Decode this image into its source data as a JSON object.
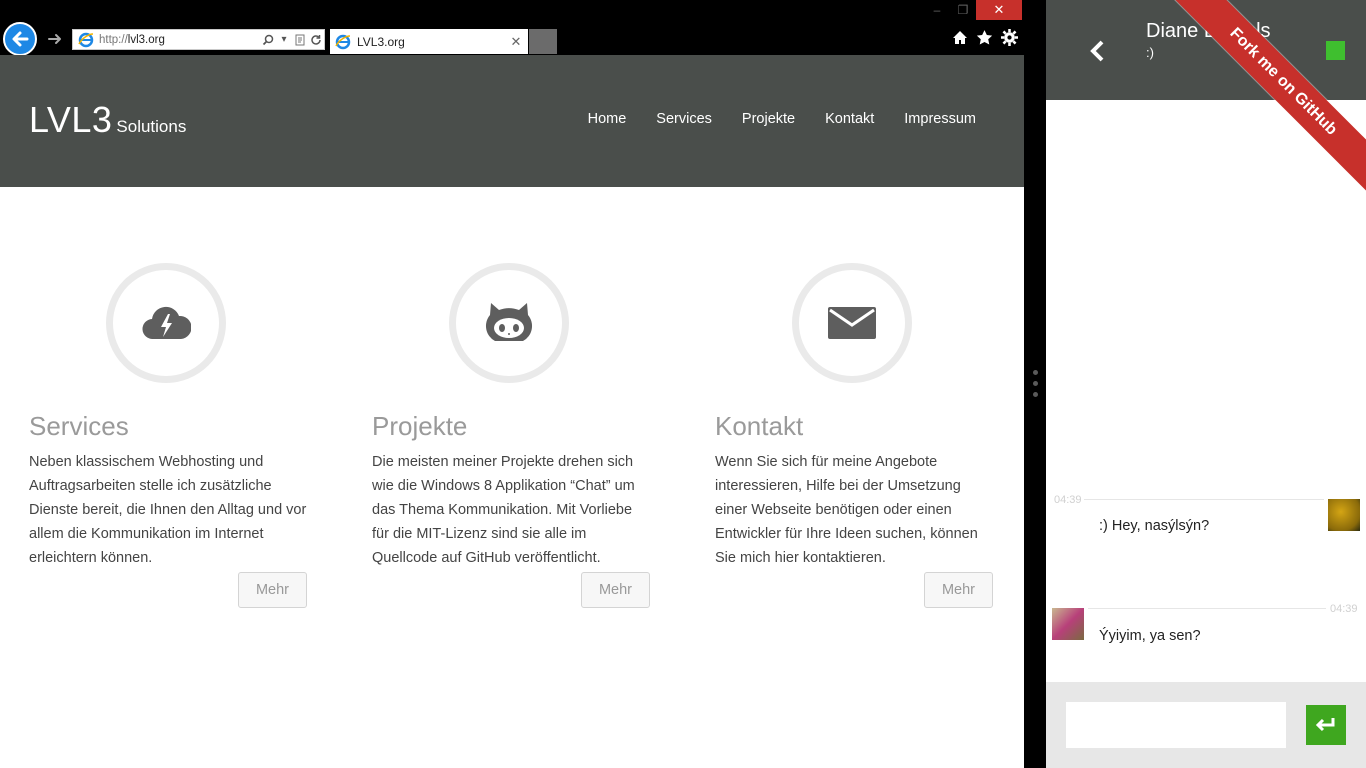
{
  "browser": {
    "address_url_dim": "http://",
    "address_url_main": "lvl3.org",
    "tab_title": "LVL3.org",
    "close_label": "✕"
  },
  "site": {
    "logo_main": "LVL3",
    "logo_sub": "Solutions",
    "nav": [
      "Home",
      "Services",
      "Projekte",
      "Kontakt",
      "Impressum"
    ],
    "features": [
      {
        "icon": "cloud-bolt-icon",
        "title": "Services",
        "text": "Neben klassischem Webhosting und Auftragsarbeiten stelle ich zusätzliche Dienste bereit, die Ihnen den Alltag und vor allem die Kommunikation im Internet erleichtern können.",
        "button": "Mehr"
      },
      {
        "icon": "github-octocat-icon",
        "title": "Projekte",
        "text": "Die meisten meiner Projekte drehen sich wie die Windows 8 Applikation “Chat” um das Thema Kommunikation. Mit Vorliebe für die MIT-Lizenz sind sie alle im Quellcode auf GitHub veröffentlicht.",
        "button": "Mehr"
      },
      {
        "icon": "envelope-icon",
        "title": "Kontakt",
        "text": "Wenn Sie sich für meine Angebote interessieren, Hilfe bei der Umsetzung einer Webseite benötigen oder einen Entwickler für Ihre Ideen suchen, können Sie mich hier kontaktieren.",
        "button": "Mehr"
      }
    ]
  },
  "chat": {
    "contact_name": "Diane Daniels",
    "contact_status": ":)",
    "presence_color": "#3fbf2f",
    "ribbon": "Fork me on GitHub",
    "messages": [
      {
        "time": "04:39",
        "text": ":) Hey, nasýlsýn?",
        "side": "right"
      },
      {
        "time": "04:39",
        "text": "Ýyiyim, ya sen?",
        "side": "left"
      }
    ],
    "input_value": ""
  },
  "colors": {
    "header_bg": "#4a4e4b",
    "ie_blue": "#1e88e5",
    "close_red": "#c7302b",
    "send_green": "#3fa71f"
  }
}
